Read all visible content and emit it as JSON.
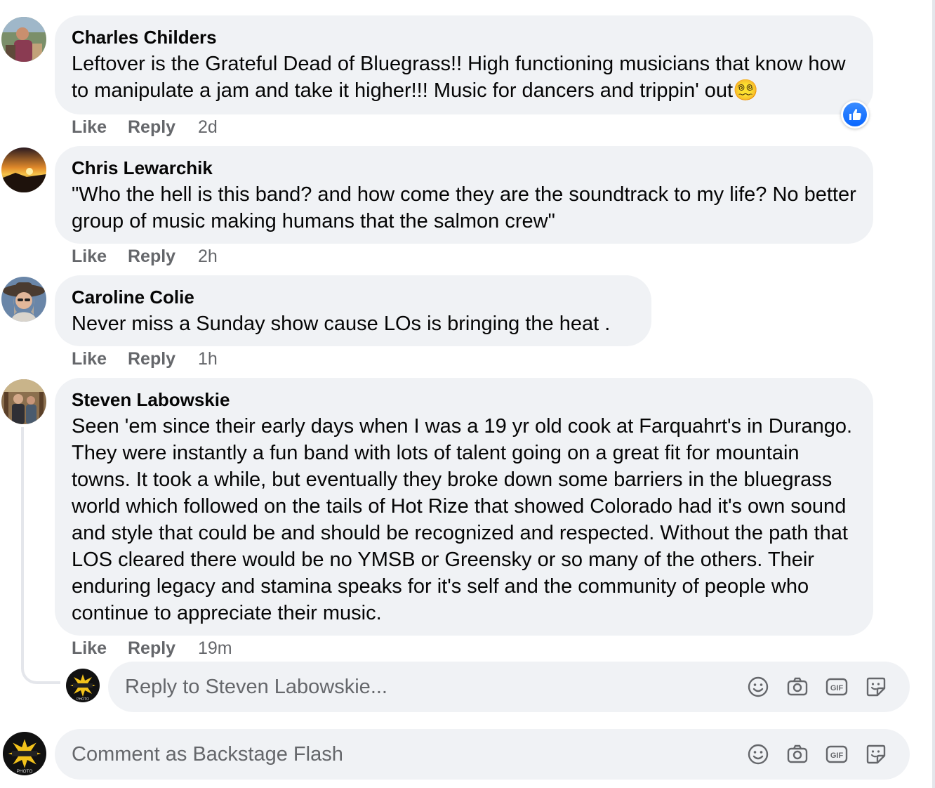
{
  "comments": [
    {
      "author": "Charles Childers",
      "text": "Leftover is the Grateful Dead of Bluegrass!! High functioning musicians that know how to manipulate a jam and take it higher!!! Music for dancers and trippin' out",
      "emoji": "😵‍💫",
      "like_label": "Like",
      "reply_label": "Reply",
      "time": "2d",
      "reaction": "like-reaction"
    },
    {
      "author": "Chris Lewarchik",
      "text": "\"Who the hell is this band? and how come they are the soundtrack to my life? No better group of music making humans that the salmon crew\"",
      "like_label": "Like",
      "reply_label": "Reply",
      "time": "2h"
    },
    {
      "author": "Caroline Colie",
      "text": "Never miss a Sunday show cause LOs is bringing the heat .",
      "like_label": "Like",
      "reply_label": "Reply",
      "time": "1h"
    },
    {
      "author": "Steven Labowskie",
      "text": "Seen 'em since their early days when I was a 19 yr old cook at Farquahrt's in Durango. They were instantly a fun band with lots of talent going on a great fit for mountain towns. It took a while, but eventually they broke down some barriers in the bluegrass world which followed on the tails of Hot Rize that showed Colorado had it's own sound and style that could be and should be recognized and respected. Without the path that LOS cleared there would be no YMSB or Greensky or so many of the others. Their enduring legacy and stamina speaks for it's self and the community of people who continue to appreciate their music.",
      "like_label": "Like",
      "reply_label": "Reply",
      "time": "19m"
    }
  ],
  "reply_box": {
    "placeholder": "Reply to Steven Labowskie..."
  },
  "comment_box": {
    "placeholder": "Comment as Backstage Flash"
  },
  "avatar_badge_text": "PHOTO",
  "icons": {
    "tools": [
      "emoji-icon",
      "camera-icon",
      "gif-icon",
      "sticker-icon"
    ],
    "gif_label": "GIF"
  },
  "colors": {
    "bubble": "#f0f2f5",
    "secondary_text": "#65676b",
    "like_blue": "#0866ff"
  }
}
